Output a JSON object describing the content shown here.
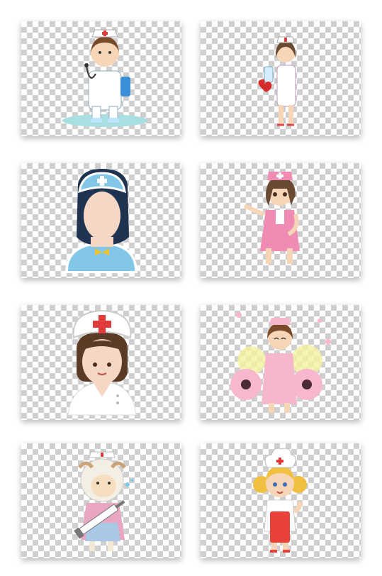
{
  "grid": {
    "tiles": [
      {
        "id": "nurse-stethoscope-clipboard"
      },
      {
        "id": "nurse-with-bottle"
      },
      {
        "id": "nurse-faceless-avatar"
      },
      {
        "id": "nurse-pink-uniform"
      },
      {
        "id": "nurse-avatar-red-cross-cap"
      },
      {
        "id": "nurse-pink-with-flowers"
      },
      {
        "id": "sheep-nurse-with-syringe"
      },
      {
        "id": "nurse-chef-hat-red-apron"
      }
    ]
  },
  "colors": {
    "checker_light": "#ffffff",
    "checker_dark": "#cfcfcf",
    "red_cross": "#e03a3a",
    "nurse_blue": "#6cc4e6",
    "nurse_pink": "#f08cb4"
  }
}
